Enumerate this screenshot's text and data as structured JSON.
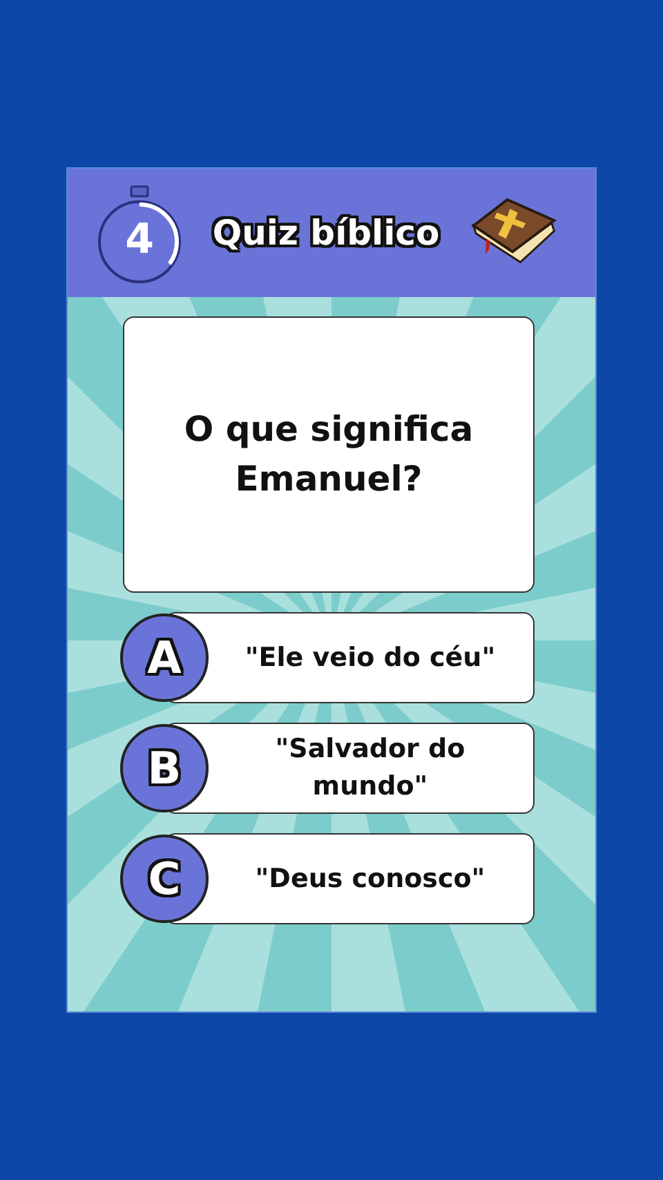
{
  "header": {
    "timer": {
      "value": "4",
      "level": 0.35
    },
    "title": "Quiz bíblico"
  },
  "question": "O que significa Emanuel?",
  "options": [
    {
      "letter": "A",
      "text": "\"Ele veio do céu\""
    },
    {
      "letter": "B",
      "text": "\"Salvador do mundo\""
    },
    {
      "letter": "C",
      "text": "\"Deus conosco\""
    }
  ]
}
